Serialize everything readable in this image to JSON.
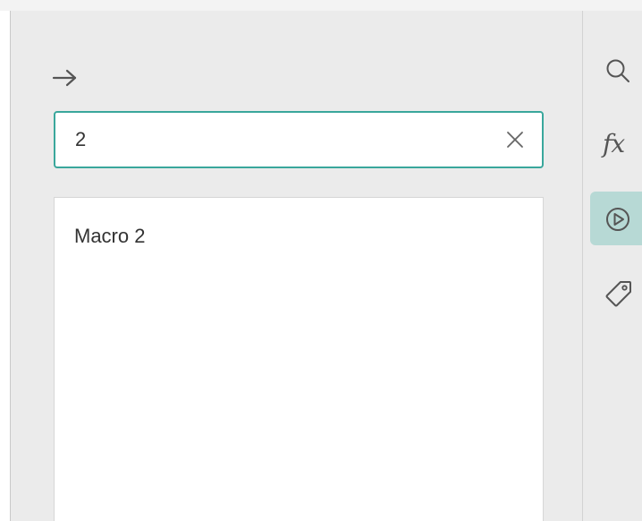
{
  "search": {
    "value": "2",
    "placeholder": ""
  },
  "results": [
    {
      "label": "Macro 2"
    }
  ],
  "rail": {
    "items": [
      {
        "icon": "search-icon"
      },
      {
        "icon": "function-icon",
        "label": "fx"
      },
      {
        "icon": "play-circle-icon",
        "active": true
      },
      {
        "icon": "tag-icon"
      }
    ]
  },
  "colors": {
    "accent": "#3aa79c",
    "active_rail_bg": "#b7d9d5",
    "panel_bg": "#ebebeb"
  }
}
